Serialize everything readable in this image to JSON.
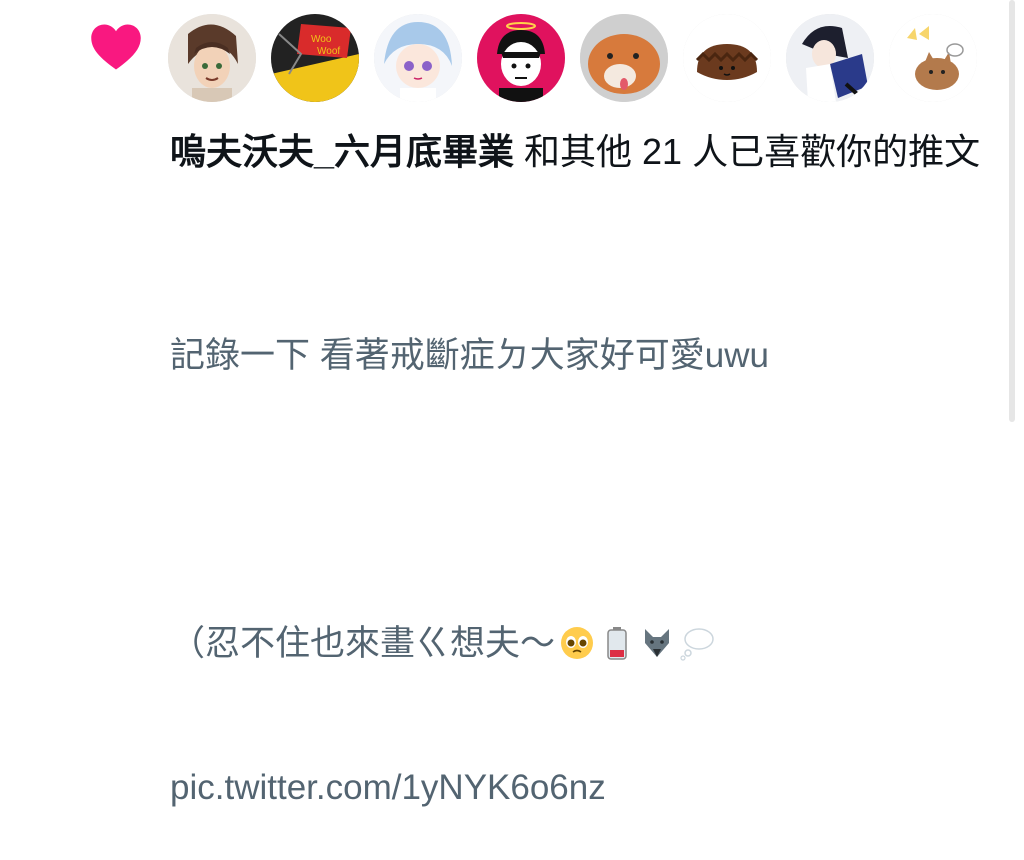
{
  "notification": {
    "user_name": "嗚夫沃夫_六月底畢業",
    "action_text": " 和其他 21 人已喜歡你的推文"
  },
  "tweet": {
    "line1": "記錄一下 看著戒斷症ㄉ大家好可愛uwu",
    "line2": "",
    "line3": "（忍不住也來畫ㄍ想夫～",
    "link": "pic.twitter.com/1yNYK6o6nz"
  },
  "icons": {
    "like": "heart-icon",
    "emoji1": "pleading-face-emoji",
    "emoji2": "low-battery-emoji",
    "emoji3": "wolf-emoji",
    "emoji4": "thought-balloon-emoji"
  },
  "colors": {
    "heart": "#f91880",
    "text": "#0f1419",
    "tweet": "#536471"
  }
}
